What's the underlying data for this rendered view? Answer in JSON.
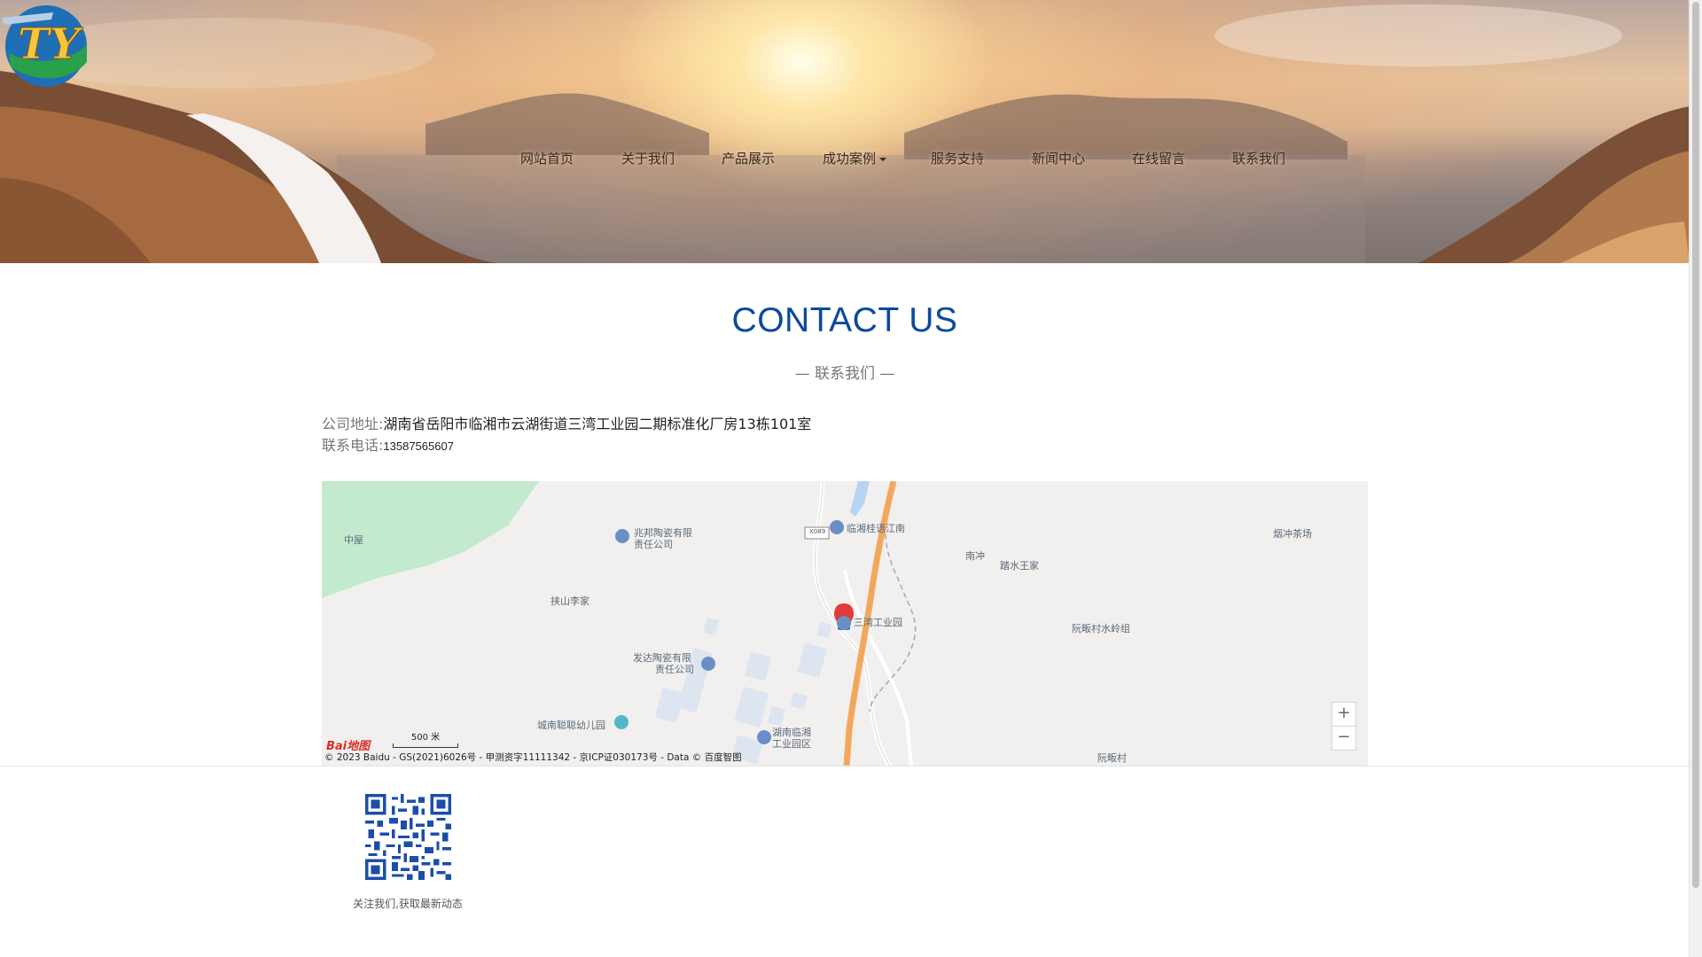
{
  "header": {
    "logo_name": "TY company logo",
    "nav": [
      {
        "label": "网站首页"
      },
      {
        "label": "关于我们"
      },
      {
        "label": "产品展示"
      },
      {
        "label": "成功案例",
        "has_dropdown": true
      },
      {
        "label": "服务支持"
      },
      {
        "label": "新闻中心"
      },
      {
        "label": "在线留言"
      },
      {
        "label": "联系我们"
      }
    ]
  },
  "contact": {
    "title": "CONTACT US",
    "subtitle": "— 联系我们 —",
    "address_label": "公司地址:",
    "address_value": "湖南省岳阳市临湘市云湖街道三湾工业园二期标准化厂房13栋101室",
    "phone_label": "联系电话:",
    "phone_value": "13587565607"
  },
  "map": {
    "labels": {
      "zhongwu": "中屋",
      "zhaobang": "兆邦陶瓷有限",
      "zhaobang2": "责任公司",
      "x089": "X089",
      "linxiang_guiyu": "临湘桂语江南",
      "nanchong": "南冲",
      "tashui": "踏水王家",
      "yanchong": "烟冲茶场",
      "jieshan": "挟山李家",
      "sanwan": "三湾工业园",
      "ruanfan_shuiling": "阮畈村水岭组",
      "fada": "发达陶瓷有限",
      "fada2": "责任公司",
      "chengnan": "城南聪聪幼儿园",
      "hunan_linxiang": "湖南临湘",
      "hunan_linxiang2": "工业园区",
      "ruanfan": "阮畈村"
    },
    "scale_text": "500 米",
    "logo_text": "Bai地图",
    "copyright": "© 2023 Baidu - GS(2021)6026号 - 甲测资字11111342 - 京ICP证030173号 - Data © 百度智图",
    "zoom_in": "+",
    "zoom_out": "−"
  },
  "footer": {
    "qr_name": "qr-code",
    "caption": "关注我们,获取最新动态"
  },
  "colors": {
    "title_blue": "#0c4a9c",
    "road_orange": "#f2a85c",
    "green_area": "#c3e9cf"
  }
}
